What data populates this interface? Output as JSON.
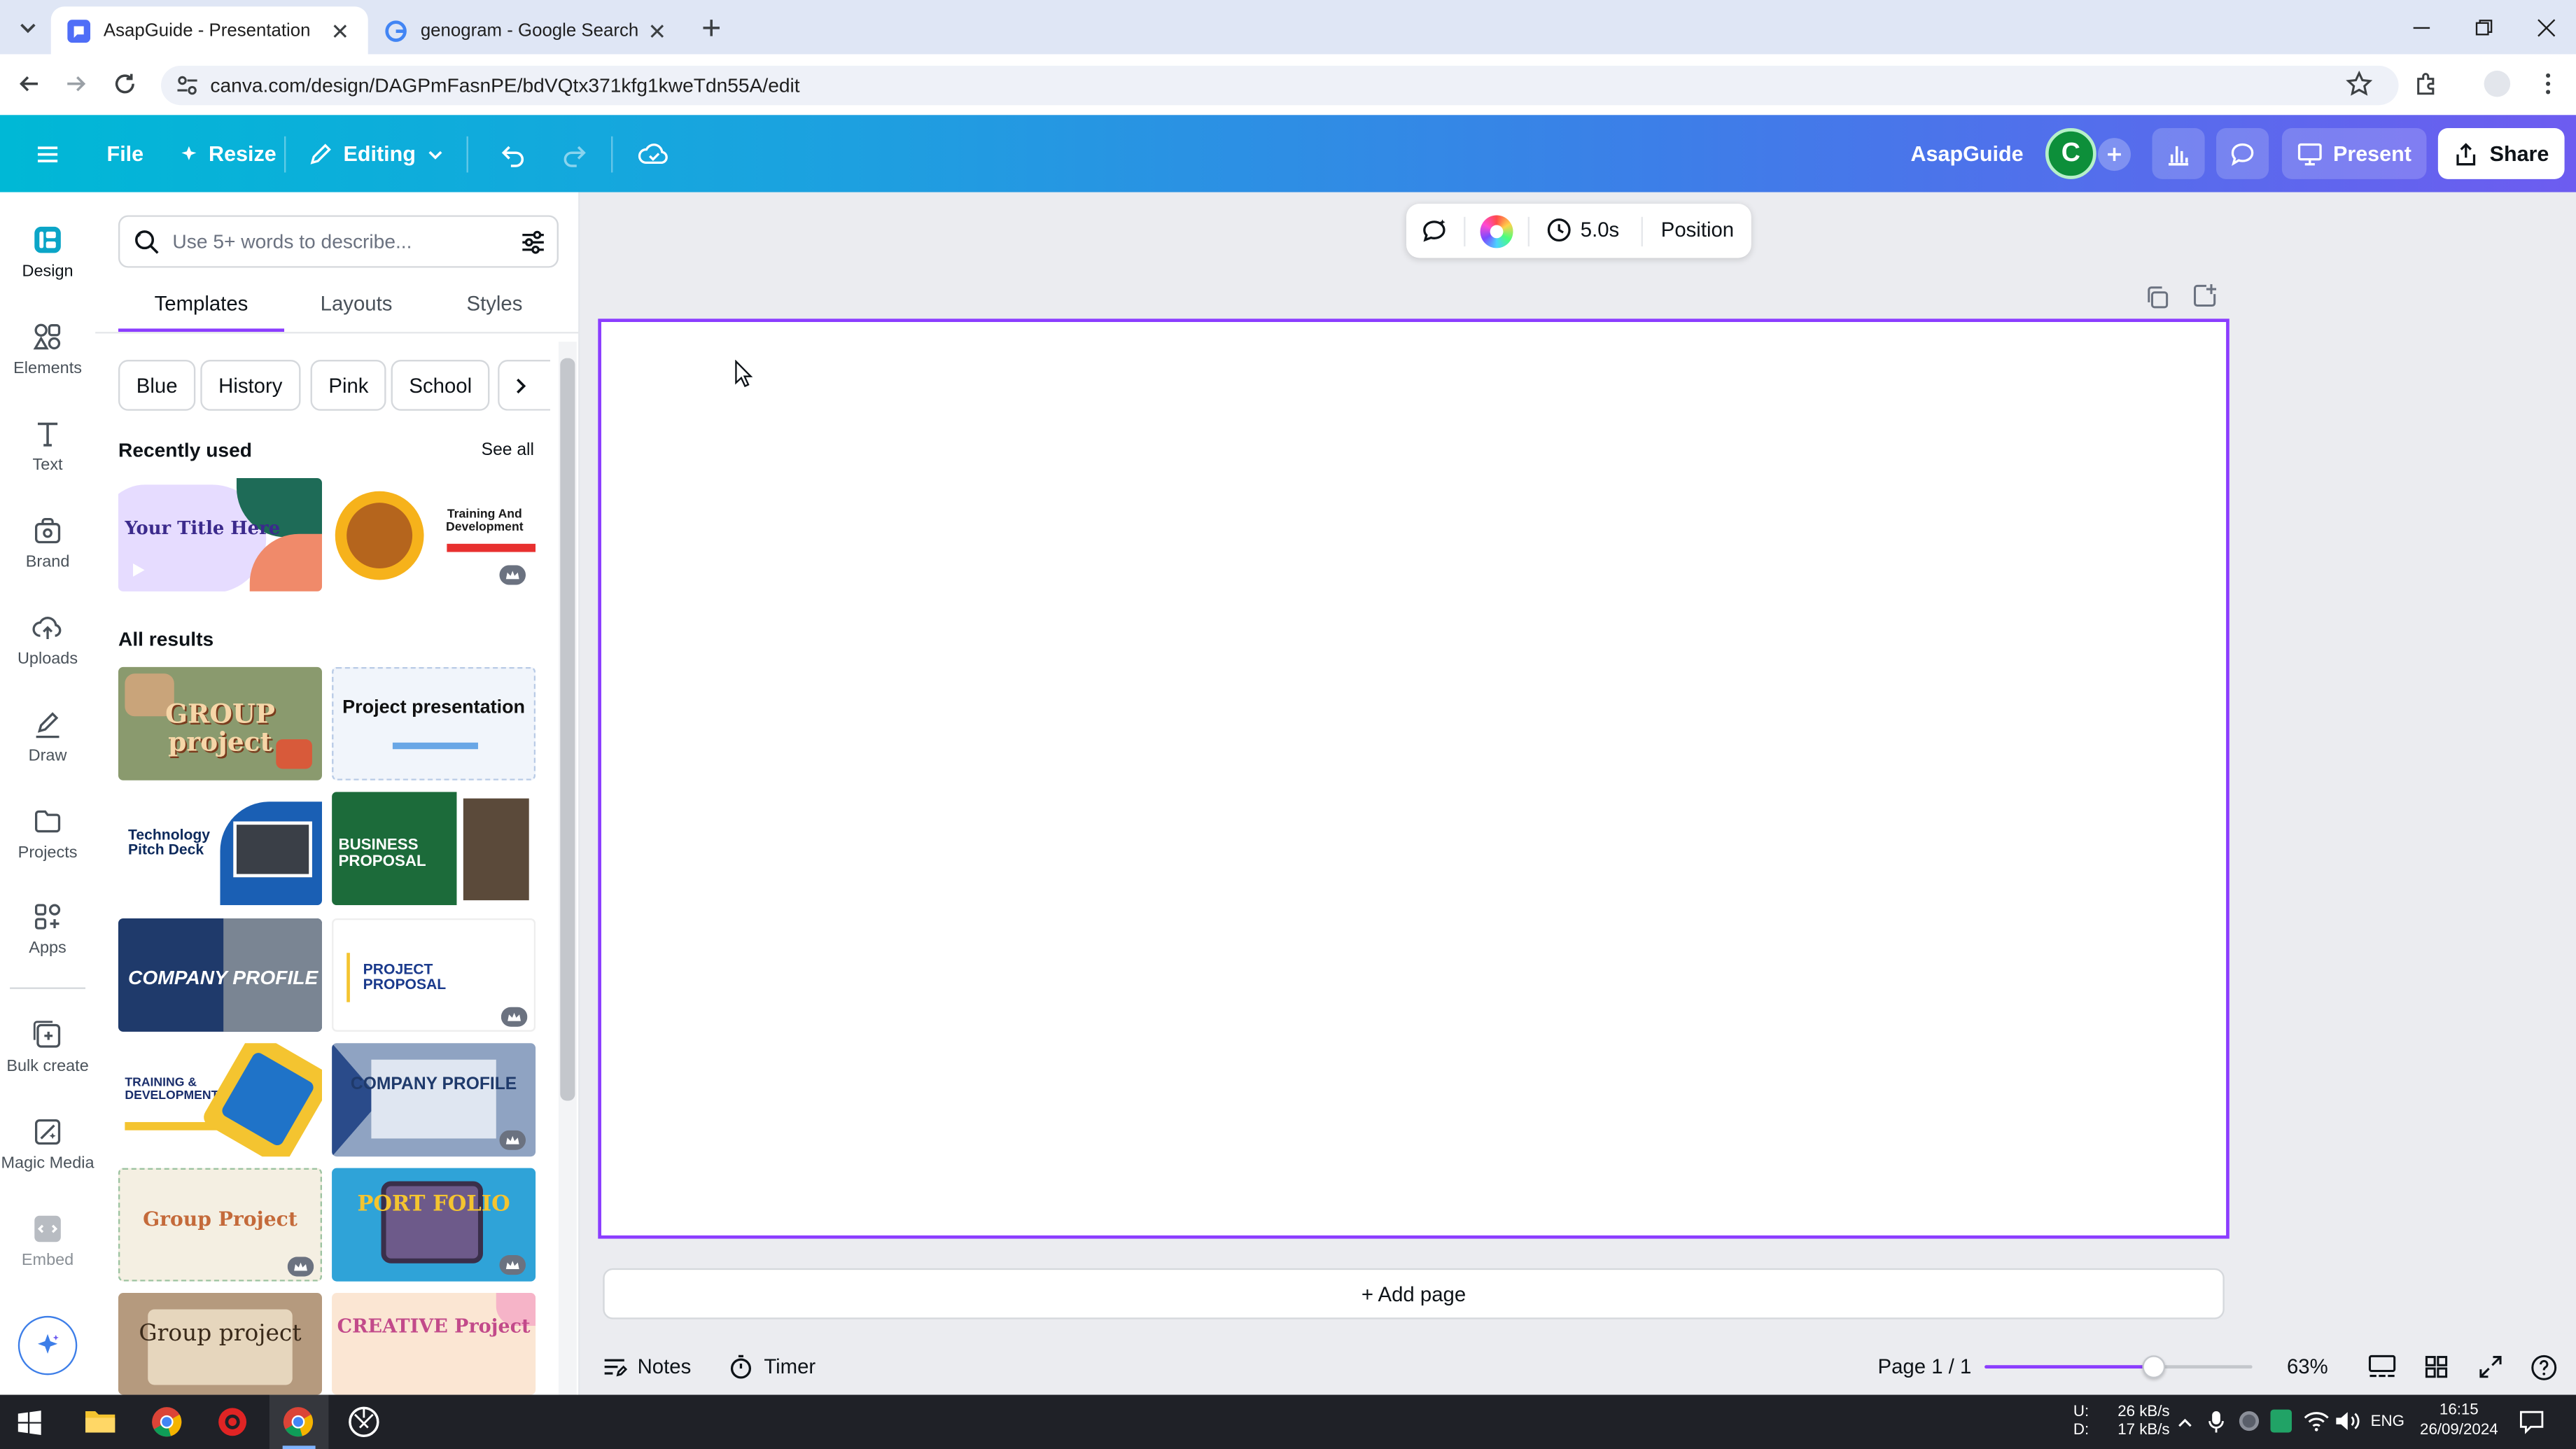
{
  "browser": {
    "tabs": [
      {
        "title": "AsapGuide - Presentation",
        "active": true
      },
      {
        "title": "genogram - Google Search",
        "active": false
      }
    ],
    "url": "canva.com/design/DAGPmFasnPE/bdVQtx371kfg1kweTdn55A/edit"
  },
  "header": {
    "file_label": "File",
    "resize_label": "Resize",
    "editing_label": "Editing",
    "design_name": "AsapGuide",
    "avatar_letter": "C",
    "present_label": "Present",
    "share_label": "Share",
    "gradient_colors": [
      "#00b8d6",
      "#3d7ee8",
      "#6d5cf0"
    ]
  },
  "rail": {
    "items": [
      {
        "label": "Design",
        "icon": "design-icon"
      },
      {
        "label": "Elements",
        "icon": "elements-icon"
      },
      {
        "label": "Text",
        "icon": "text-icon"
      },
      {
        "label": "Brand",
        "icon": "brand-icon"
      },
      {
        "label": "Uploads",
        "icon": "uploads-icon"
      },
      {
        "label": "Draw",
        "icon": "draw-icon"
      },
      {
        "label": "Projects",
        "icon": "projects-icon"
      },
      {
        "label": "Apps",
        "icon": "apps-icon"
      },
      {
        "label": "Bulk create",
        "icon": "bulk-create-icon"
      },
      {
        "label": "Magic Media",
        "icon": "magic-media-icon"
      },
      {
        "label": "Embed",
        "icon": "embed-icon"
      }
    ]
  },
  "panel": {
    "search_placeholder": "Use 5+ words to describe...",
    "tabs": [
      "Templates",
      "Layouts",
      "Styles"
    ],
    "active_tab": "Templates",
    "chips": [
      "Blue",
      "History",
      "Pink",
      "School"
    ],
    "recent_heading": "Recently used",
    "see_all": "See all",
    "recent": [
      {
        "title": "Your Title Here"
      },
      {
        "title": "Training And Development"
      }
    ],
    "all_heading": "All results",
    "results": [
      {
        "title": "GROUP project"
      },
      {
        "title": "Project presentation"
      },
      {
        "title": "Technology Pitch Deck"
      },
      {
        "title": "BUSINESS PROPOSAL"
      },
      {
        "title": "COMPANY PROFILE"
      },
      {
        "title": "PROJECT PROPOSAL"
      },
      {
        "title": "TRAINING & DEVELOPMENT"
      },
      {
        "title": "COMPANY PROFILE"
      },
      {
        "title": "Group Project"
      },
      {
        "title": "PORT FOLIO"
      },
      {
        "title": "Group project"
      },
      {
        "title": "CREATIVE Project"
      }
    ]
  },
  "canvas": {
    "toolbar_duration": "5.0s",
    "toolbar_position": "Position",
    "add_page": "+ Add page",
    "accent": "#8b3dff"
  },
  "footer": {
    "notes": "Notes",
    "timer": "Timer",
    "page": "Page 1 / 1",
    "zoom": "63%",
    "zoom_fraction": 0.63
  },
  "taskbar": {
    "upload": "26 kB/s",
    "download": "17 kB/s",
    "up_label": "U:",
    "down_label": "D:",
    "lang": "ENG",
    "time": "16:15",
    "date": "26/09/2024"
  }
}
